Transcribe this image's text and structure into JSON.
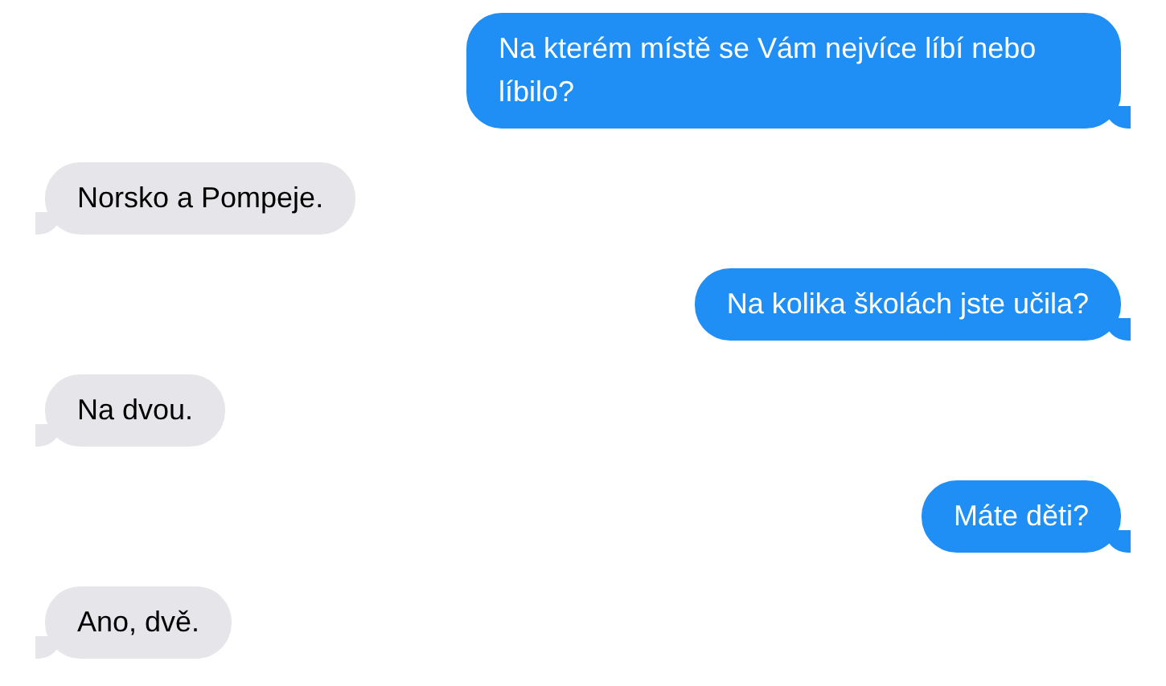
{
  "messages": [
    {
      "kind": "sent",
      "text": "Na kterém místě se Vám nejvíce líbí nebo líbilo?"
    },
    {
      "kind": "received",
      "text": "Norsko a Pompeje."
    },
    {
      "kind": "sent",
      "text": "Na kolika školách jste učila?"
    },
    {
      "kind": "received",
      "text": "Na dvou."
    },
    {
      "kind": "sent",
      "text": "Máte děti?"
    },
    {
      "kind": "received",
      "text": "Ano, dvě."
    }
  ]
}
